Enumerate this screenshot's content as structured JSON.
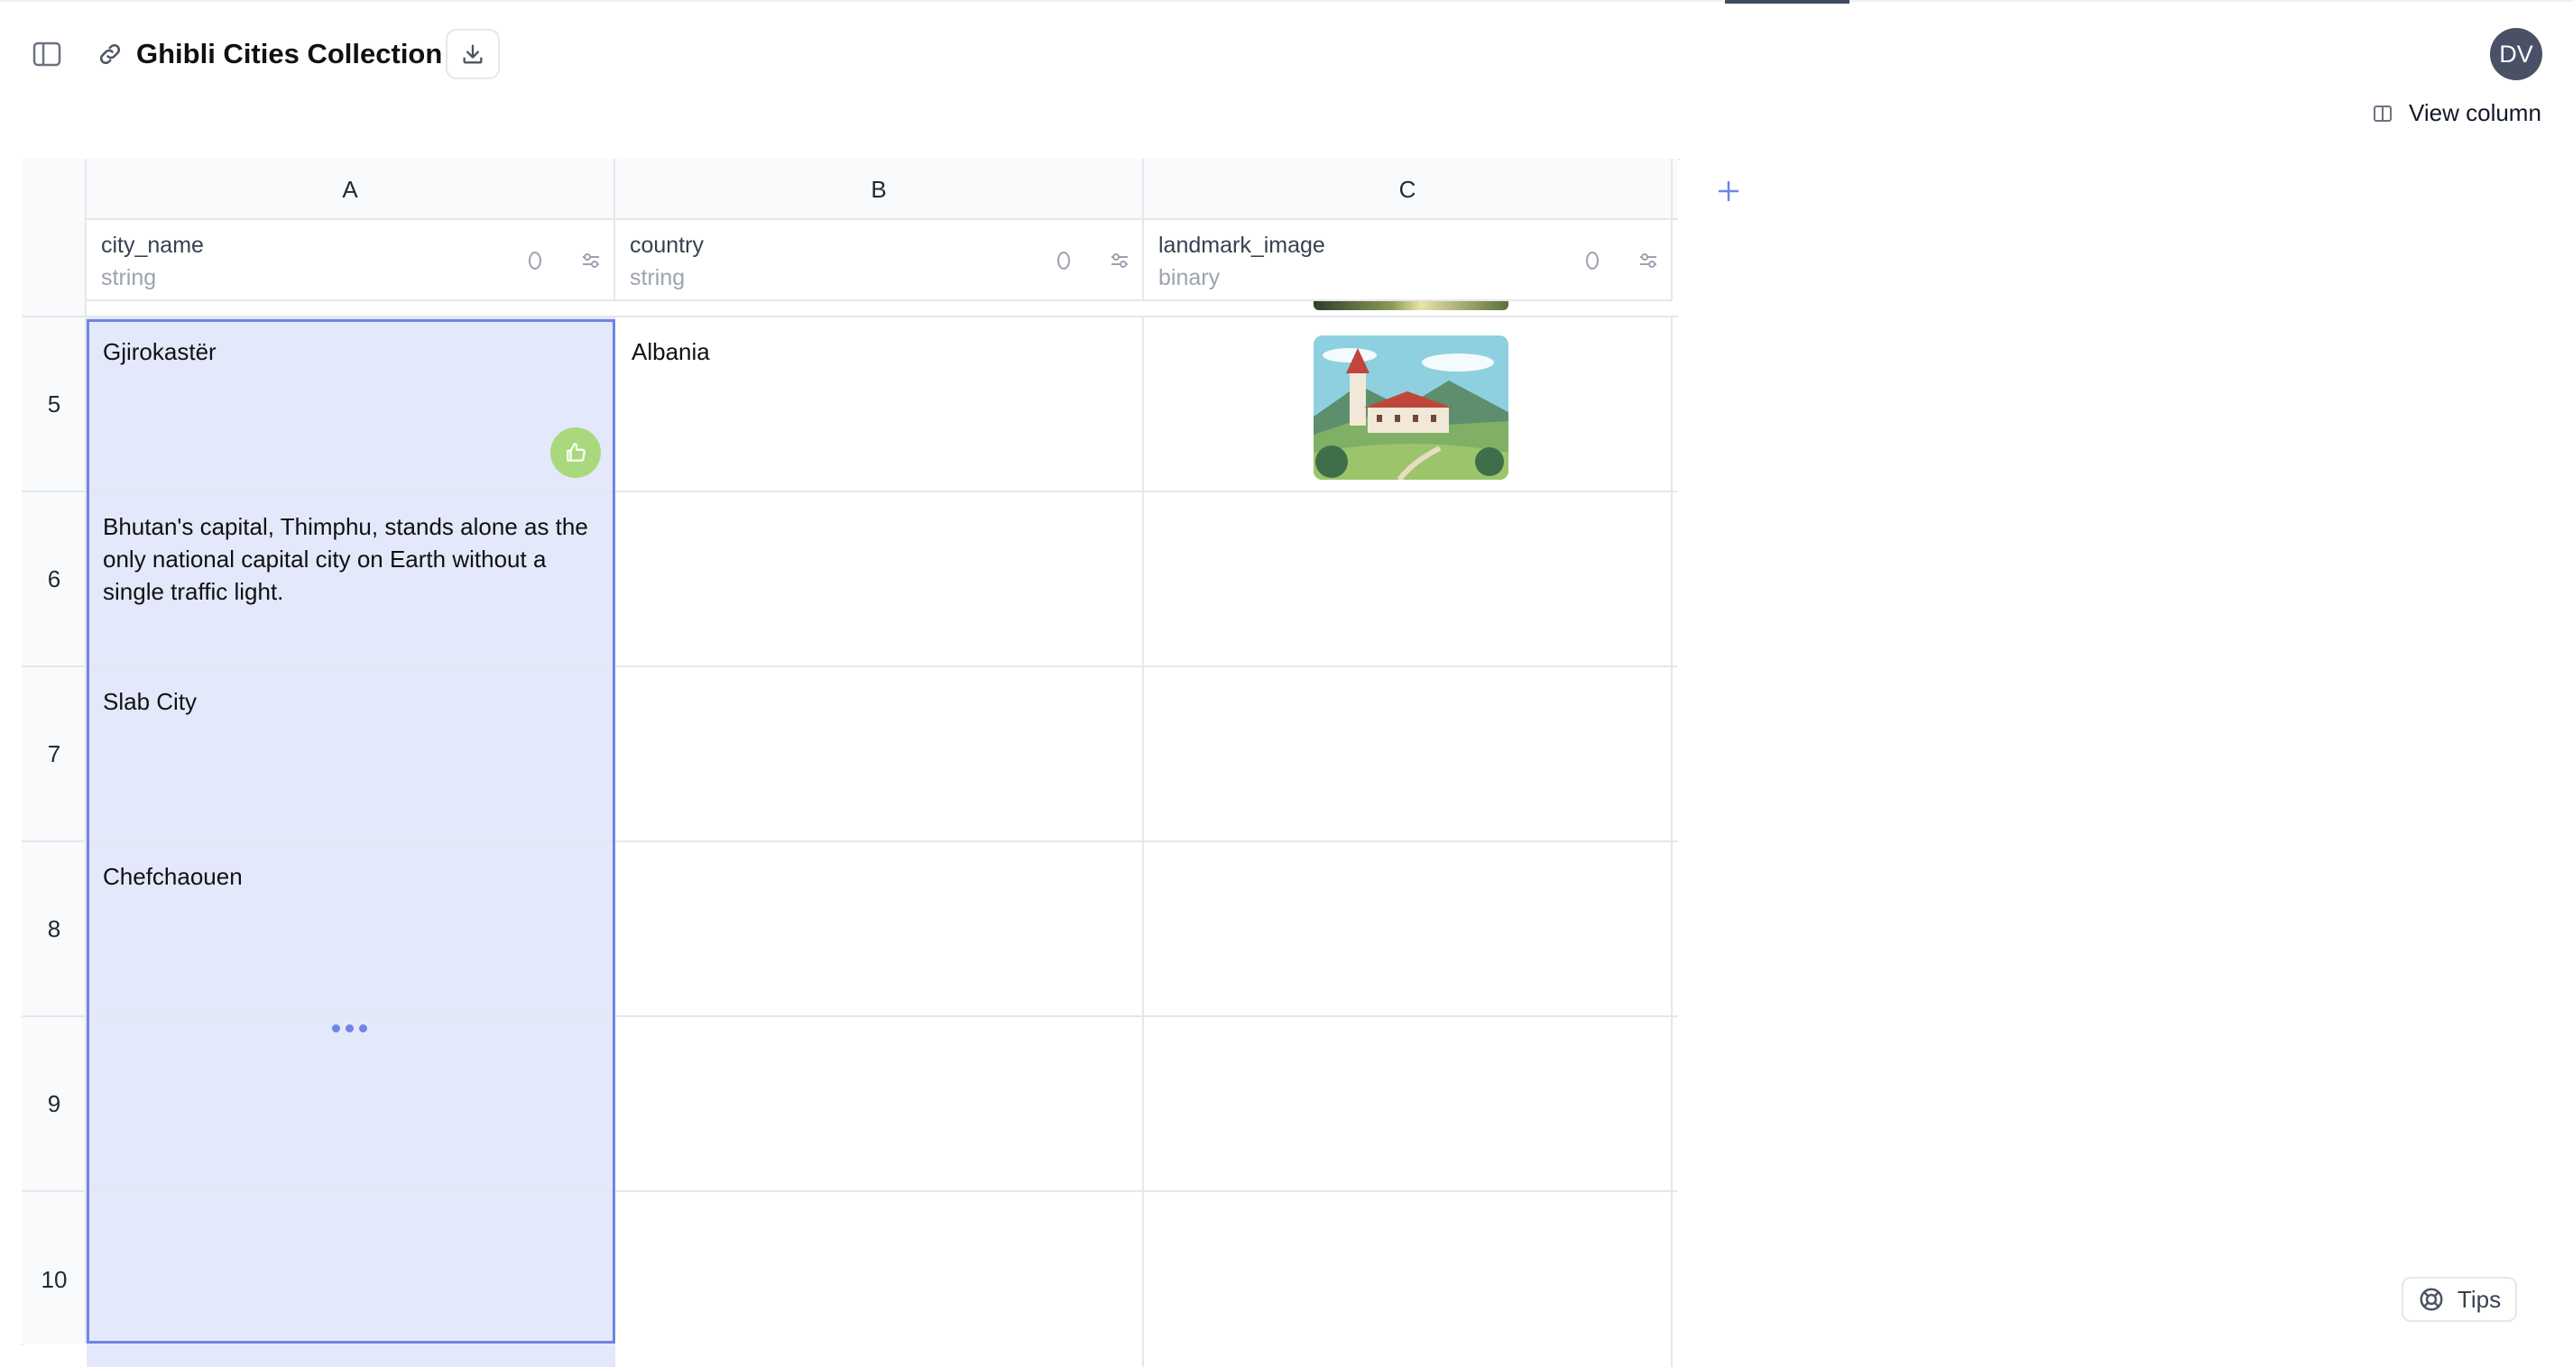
{
  "header": {
    "title": "Ghibli Cities Collection",
    "avatar_initials": "DV"
  },
  "toolbar": {
    "view_column_label": "View column"
  },
  "columns": [
    {
      "letter": "A",
      "name": "city_name",
      "type": "string"
    },
    {
      "letter": "B",
      "name": "country",
      "type": "string"
    },
    {
      "letter": "C",
      "name": "landmark_image",
      "type": "binary"
    }
  ],
  "rows": [
    {
      "num": "5",
      "city_name": "Gjirokastër",
      "country": "Albania",
      "has_image": true
    },
    {
      "num": "6",
      "city_name": "Bhutan's capital, Thimphu, stands alone as the only national capital city on Earth without a single traffic light.",
      "country": "",
      "has_image": false
    },
    {
      "num": "7",
      "city_name": "Slab City",
      "country": "",
      "has_image": false
    },
    {
      "num": "8",
      "city_name": "Chefchaouen",
      "country": "",
      "has_image": false
    },
    {
      "num": "9",
      "city_name": "",
      "country": "",
      "has_image": false
    },
    {
      "num": "10",
      "city_name": "",
      "country": "",
      "has_image": false
    }
  ],
  "footer": {
    "tips_label": "Tips"
  },
  "colors": {
    "selection_fill": "#e4e8fb",
    "selection_border": "#6f84e6",
    "thumb_badge": "#a9d97c",
    "avatar_bg": "#4a5065"
  },
  "icons": [
    "sidebar-toggle-icon",
    "link-icon",
    "download-icon",
    "columns-icon",
    "sparkle-icon",
    "settings-sliders-icon",
    "plus-icon",
    "thumbs-up-icon",
    "lifebuoy-icon"
  ]
}
